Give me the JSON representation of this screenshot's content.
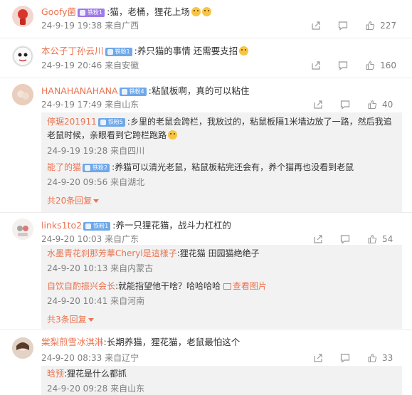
{
  "comments": [
    {
      "username": "Goofy菌",
      "badge": "铁粉1",
      "text": ":猫，老桶，狸花上场",
      "time": "24-9-19 19:38",
      "location": "来自广西",
      "likes": "227"
    },
    {
      "username": "本公子丁孙云川",
      "badge": "铁粉1",
      "text": ":养只猫的事情 还需要支招",
      "time": "24-9-19 20:46",
      "location": "来自安徽",
      "likes": "160"
    },
    {
      "username": "HANAHANAHANA",
      "badge": "铁粉4",
      "text": ":粘鼠板啊，真的可以粘住",
      "time": "24-9-19 17:49",
      "location": "来自山东",
      "likes": "40",
      "replies": [
        {
          "username": "停琚201911",
          "badge": "铁粉5",
          "text": ":乡里的老鼠会跨栏，我放过的，粘鼠板隔1米墙边放了一路，然后我追老鼠时候，亲眼看到它跨栏跑路",
          "time": "24-9-19 19:28",
          "location": "来自四川"
        },
        {
          "username": "能了的猫",
          "badge": "铁粉2",
          "text": ":养猫可以清光老鼠，粘鼠板粘完还会有，养个猫再也没看到老鼠",
          "time": "24-9-20 09:56",
          "location": "来自湖北"
        }
      ],
      "more": "共20条回复"
    },
    {
      "username": "links1to2",
      "badge": "铁粉1",
      "text": ":养一只狸花猫，战斗力杠杠的",
      "time": "24-9-20 10:03",
      "location": "来自广东",
      "likes": "54",
      "replies": [
        {
          "username": "水墨青花刹那芳華Cheryl是這樣子",
          "text": ":狸花猫 田园猫绝绝子",
          "time": "24-9-20 10:13",
          "location": "来自内蒙古"
        },
        {
          "username": "自饮自酌振兴会长",
          "text": ":就能指望他干啥？哈哈哈哈",
          "image_link": "查看图片",
          "time": "24-9-20 10:41",
          "location": "来自河南"
        }
      ],
      "more": "共3条回复"
    },
    {
      "username": "棠梨煎雪冰淇淋",
      "text": ":长期养猫，狸花猫，老鼠最怕这个",
      "time": "24-9-20 08:33",
      "location": "来自辽宁",
      "likes": "33",
      "replies": [
        {
          "username": "晗预",
          "text": ":狸花是什么都抓",
          "time": "24-9-20 09:28",
          "location": "来自山东"
        }
      ]
    }
  ],
  "colors": {
    "accent": "#eb7350",
    "meta": "#808080",
    "reply_bg": "#f2f2f2"
  }
}
